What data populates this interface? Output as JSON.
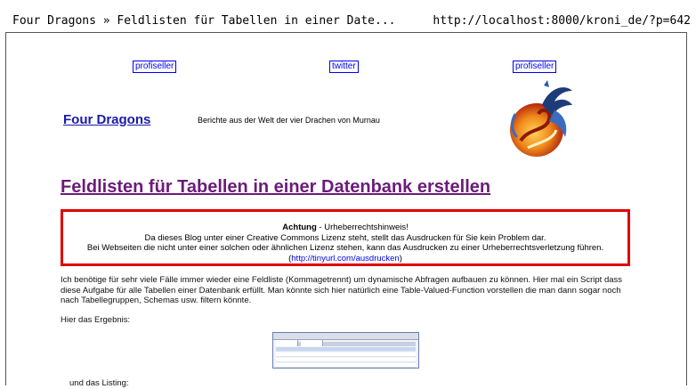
{
  "print_header": {
    "title": "Four Dragons » Feldlisten für Tabellen in einer Date...",
    "url": "http://localhost:8000/kroni_de/?p=642"
  },
  "nav": {
    "links": [
      "profiseller",
      "twitter",
      "profiseller"
    ]
  },
  "site": {
    "title": "Four Dragons",
    "description": "Berichte aus der Welt der vier Drachen von Murnau",
    "logo_icon": "dragon-logo-icon"
  },
  "post": {
    "title": "Feldlisten für Tabellen in einer Datenbank erstellen"
  },
  "notice": {
    "heading": "Achtung",
    "heading_suffix": " - Urheberrechtshinweis!",
    "line1": "Da dieses Blog unter einer Creative Commons Lizenz steht, stellt das Ausdrucken für Sie kein Problem dar.",
    "line2": "Bei Webseiten die nicht unter einer solchen oder ähnlichen Lizenz stehen, kann das Ausdrucken zu einer Urheberrechtsverletzung führen. (",
    "link": "http://tinyurl.com/ausdrucken",
    "line2_end": ")",
    "border_color": "#e00000"
  },
  "content": {
    "paragraph1": "Ich benötige für sehr viele Fälle immer wieder eine Feldliste (Kommagetrennt) um dynamische Abfragen aufbauen zu können. Hier mal ein Script dass diese Aufgabe für alle Tabellen einer Datenbank erfüllt. Man könnte sich hier natürlich eine Table-Valued-Function vorstellen die man dann sogar noch nach Tabellegruppen, Schemas usw. filtern könnte.",
    "paragraph2": "Hier das Ergebnis:",
    "paragraph3": "und das Listing:"
  }
}
